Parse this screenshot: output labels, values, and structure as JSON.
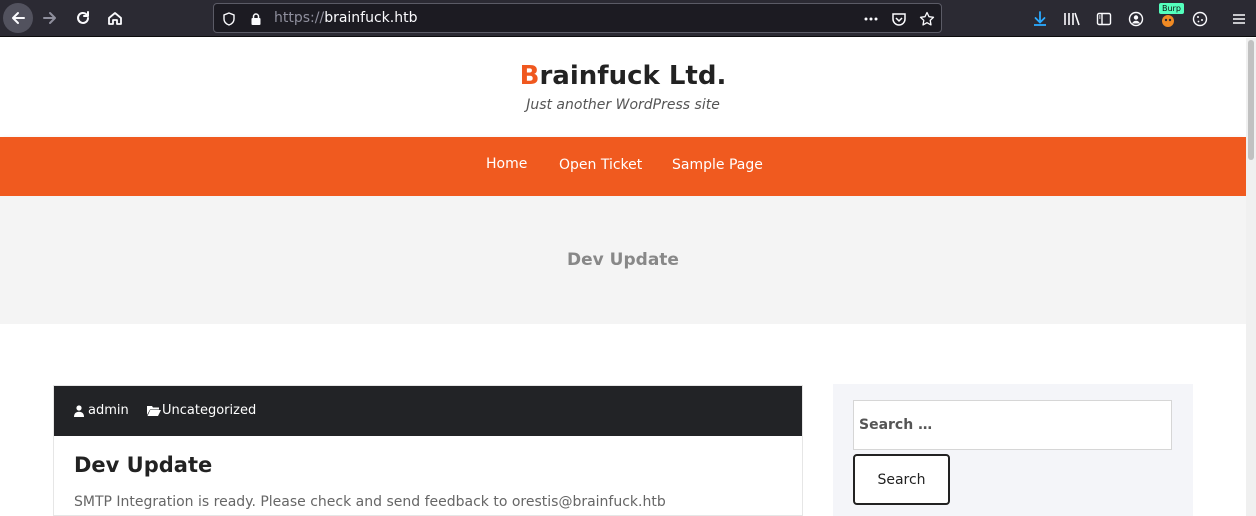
{
  "browser": {
    "url_scheme": "https://",
    "url_host": "brainfuck.htb",
    "extension_badge": "Burp"
  },
  "site": {
    "title_first_letter": "B",
    "title_rest": "rainfuck Ltd.",
    "tagline": "Just another WordPress site",
    "accent_color": "#f05a1f"
  },
  "nav": {
    "items": [
      {
        "label": "Home"
      },
      {
        "label": "Open Ticket"
      },
      {
        "label": "Sample Page"
      }
    ]
  },
  "hero": {
    "title": "Dev Update"
  },
  "post": {
    "author": "admin",
    "category": "Uncategorized",
    "title": "Dev Update",
    "excerpt": "SMTP Integration is ready. Please check and send feedback to orestis@brainfuck.htb"
  },
  "sidebar": {
    "search_placeholder": "Search …",
    "search_button": "Search"
  }
}
